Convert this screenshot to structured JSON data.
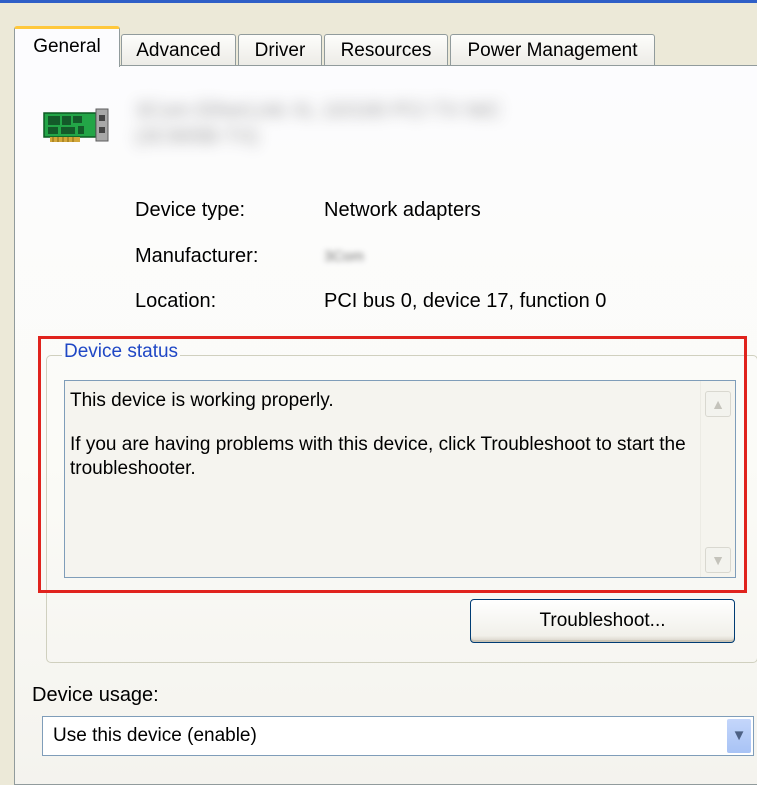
{
  "tabs": [
    {
      "label": "General",
      "active": true
    },
    {
      "label": "Advanced"
    },
    {
      "label": "Driver"
    },
    {
      "label": "Resources"
    },
    {
      "label": "Power Management"
    }
  ],
  "device": {
    "icon": "network-adapter-icon",
    "name": "3Com EtherLink XL 10/100 PCI TX NIC (3C905B-TX)"
  },
  "properties": {
    "type_label": "Device type:",
    "type_value": "Network adapters",
    "manufacturer_label": "Manufacturer:",
    "manufacturer_value": "3Com",
    "location_label": "Location:",
    "location_value": "PCI bus 0, device 17, function 0"
  },
  "status": {
    "legend": "Device status",
    "line1": "This device is working properly.",
    "line2": "If you are having problems with this device, click Troubleshoot to start the troubleshooter.",
    "troubleshoot_label": "Troubleshoot..."
  },
  "usage": {
    "label": "Device usage:",
    "selected": "Use this device (enable)"
  },
  "colors": {
    "highlight": "#e0231d",
    "legend_text": "#1f47c5",
    "active_tab_accent": "#ffc83c"
  }
}
